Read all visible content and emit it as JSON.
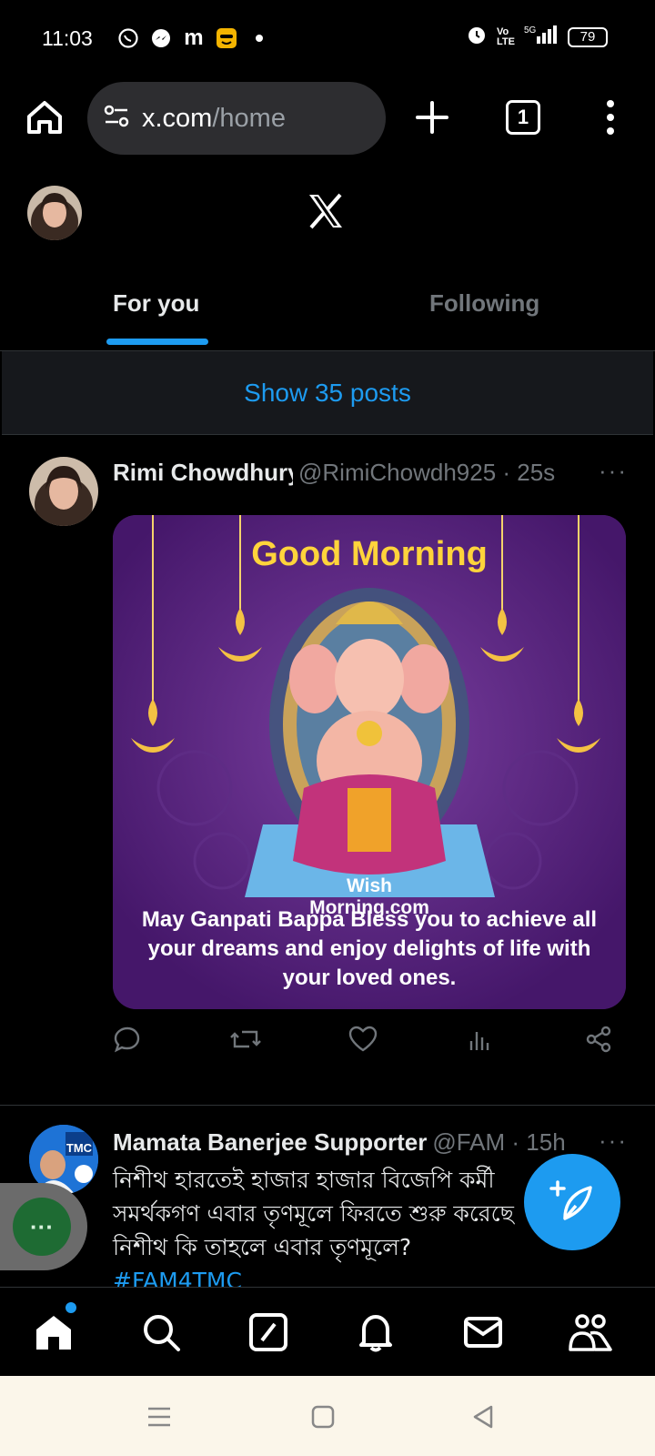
{
  "status_bar": {
    "time": "11:03",
    "battery": "79",
    "icons": [
      "whatsapp-icon",
      "messenger-icon",
      "m-app-icon",
      "emoji-app-icon",
      "dot-icon",
      "alarm-icon",
      "volte-icon",
      "signal-5g-icon",
      "battery-icon"
    ]
  },
  "browser": {
    "url_domain": "x.com",
    "url_path": "/home",
    "tab_count": "1"
  },
  "tabs": {
    "for_you": "For you",
    "following": "Following"
  },
  "show_posts": "Show 35 posts",
  "post1": {
    "name": "Rimi Chowdhury",
    "handle": "@RimiChowdh925 · 25s",
    "more": "···",
    "media": {
      "title": "Good Morning",
      "brand_line1": "Wish",
      "brand_line2": "Morning.com",
      "caption": "May Ganpati Bappa Bless you to achieve all your dreams and enjoy delights of life with your loved ones."
    }
  },
  "post2": {
    "name": "Mamata Banerjee Supporter",
    "handle": "@FAM · 15h",
    "more": "···",
    "avatar_text": "VOTE FOR TMC",
    "text": "নিশীথ হারতেই হাজার হাজার বিজেপি কর্মী সমর্থকগণ এবার তৃণমূলে ফিরতে শুরু করেছে নিশীথ কি তাহলে এবার তৃণমূলে?",
    "hashtag": "#FAM4TMC"
  },
  "bubble_label": "···",
  "colors": {
    "accent": "#1d9bf0",
    "background": "#000000",
    "secondary_text": "#71767b"
  }
}
